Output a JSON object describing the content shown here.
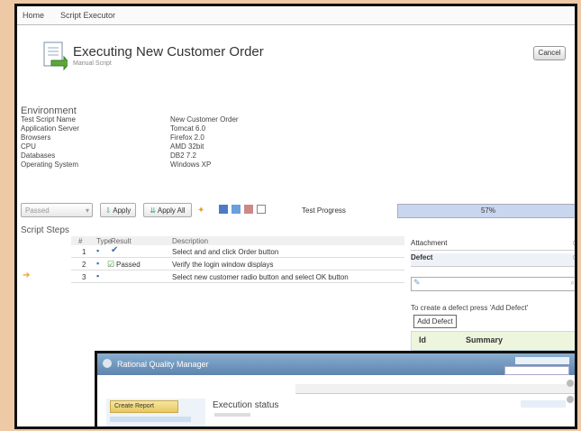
{
  "tabs": [
    "Home",
    "Script Executor"
  ],
  "header": {
    "title": "Executing New Customer Order",
    "subtitle": "Manual Script",
    "cancel": "Cancel"
  },
  "environment": {
    "heading": "Environment",
    "rows": [
      {
        "label": "Test Script Name",
        "value": "New Customer Order"
      },
      {
        "label": "Application Server",
        "value": "Tomcat 6.0"
      },
      {
        "label": "Browsers",
        "value": "Firefox 2.0"
      },
      {
        "label": "CPU",
        "value": "AMD 32bit"
      },
      {
        "label": "Databases",
        "value": "DB2 7.2"
      },
      {
        "label": "Operating System",
        "value": "Windows XP"
      }
    ]
  },
  "toolbar": {
    "status_select": "Passed",
    "apply": "Apply",
    "apply_all": "Apply All",
    "progress_label": "Test Progress",
    "progress_value": "57%",
    "progress_fraction": 0.57
  },
  "steps": {
    "heading": "Script Steps",
    "columns": [
      "#",
      "Type",
      "Result",
      "Description"
    ],
    "rows": [
      {
        "num": "1",
        "result": "",
        "desc": "Select and and click Order button"
      },
      {
        "num": "2",
        "result": "Passed",
        "desc": "Verify the login window displays"
      },
      {
        "num": "3",
        "result": "",
        "desc": "Select new customer radio button and select OK button"
      }
    ]
  },
  "side": {
    "attachment": "Attachment",
    "defect": "Defect",
    "hint": "To create a defect press 'Add Defect'",
    "add_defect": "Add Defect",
    "col_id": "Id",
    "col_summary": "Summary"
  },
  "inset": {
    "title": "Rational Quality Manager",
    "create_button": "Create Report",
    "heading": "Execution status"
  },
  "colors": {
    "accent": "#5d84ad",
    "progress": "#c8d6ee"
  }
}
